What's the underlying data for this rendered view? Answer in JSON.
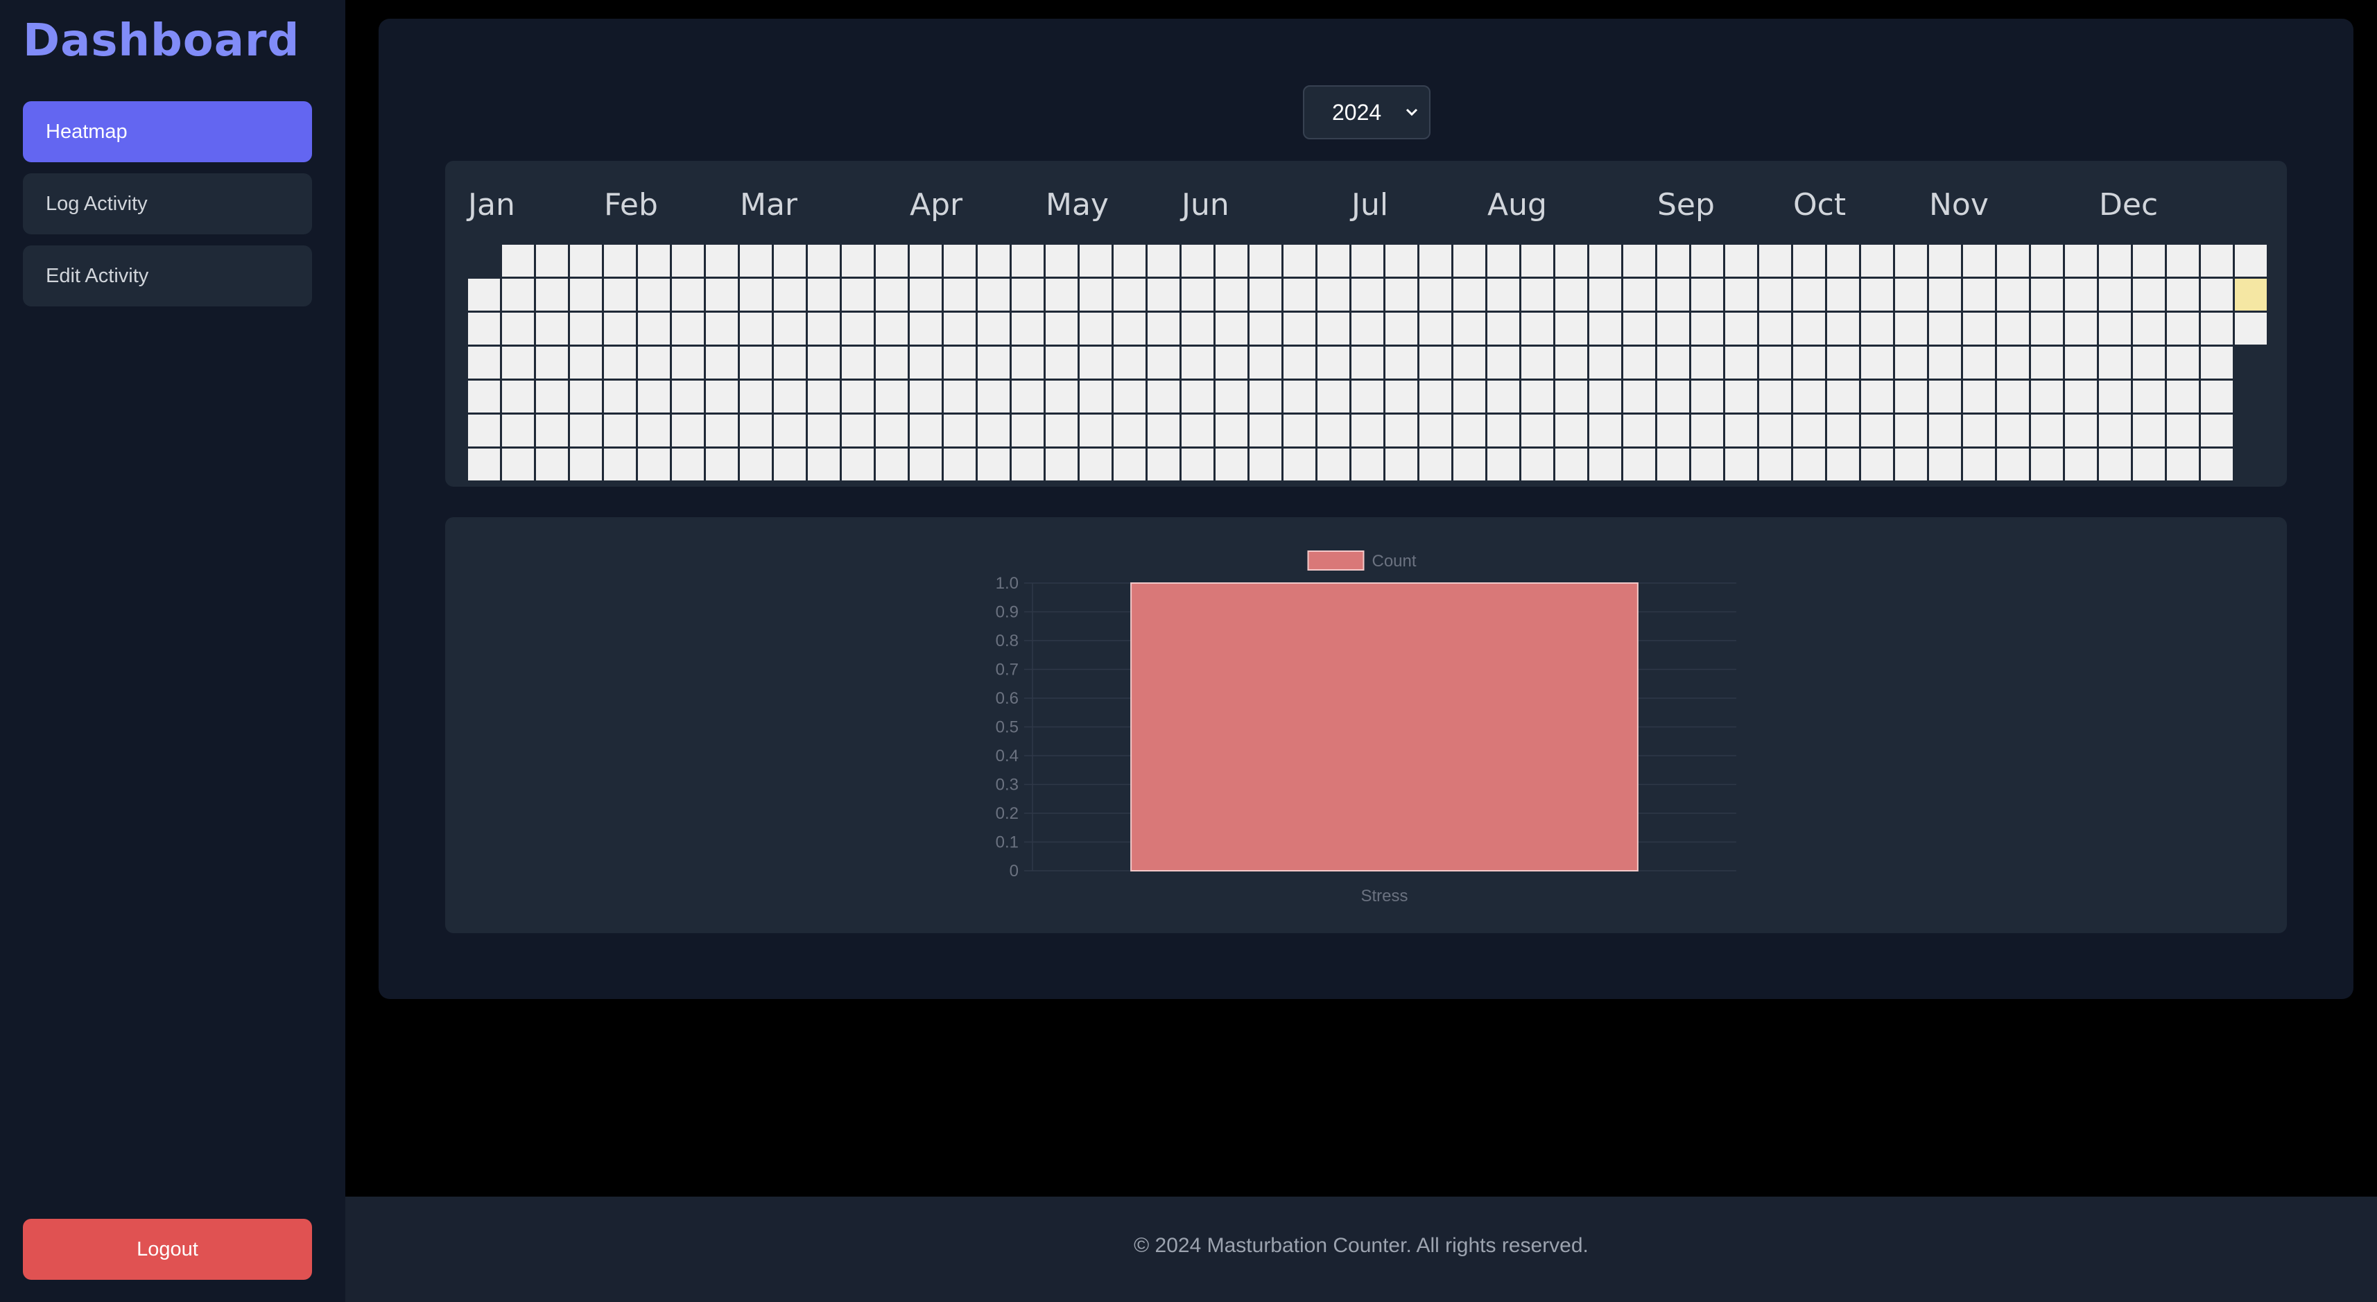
{
  "sidebar": {
    "brand": "Dashboard",
    "items": [
      {
        "label": "Heatmap",
        "active": true
      },
      {
        "label": "Log Activity",
        "active": false
      },
      {
        "label": "Edit Activity",
        "active": false
      }
    ],
    "logout_label": "Logout"
  },
  "year_select": {
    "selected": "2024",
    "chevron": "chevron-down-icon"
  },
  "heatmap": {
    "year": 2024,
    "months": [
      "Jan",
      "Feb",
      "Mar",
      "Apr",
      "May",
      "Jun",
      "Jul",
      "Aug",
      "Sep",
      "Oct",
      "Nov",
      "Dec"
    ],
    "active_dates": [
      "2024-12-30"
    ],
    "empty_color": "#f0f0f0",
    "active_color": "#f5e7a3"
  },
  "chart_data": {
    "type": "bar",
    "categories": [
      "Stress"
    ],
    "series": [
      {
        "name": "Count",
        "values": [
          1
        ]
      }
    ],
    "ylim": [
      0,
      1
    ],
    "yticks": [
      0,
      0.1,
      0.2,
      0.3,
      0.4,
      0.5,
      0.6,
      0.7,
      0.8,
      0.9,
      1.0
    ],
    "ytick_labels": [
      "0",
      "0.1",
      "0.2",
      "0.3",
      "0.4",
      "0.5",
      "0.6",
      "0.7",
      "0.8",
      "0.9",
      "1.0"
    ],
    "legend_position": "top",
    "bar_color": "#d97878",
    "grid": true
  },
  "footer": {
    "text": "© 2024 Masturbation Counter. All rights reserved."
  },
  "colors": {
    "accent": "#6366f1",
    "brand": "#818cf8",
    "danger": "#e05252",
    "panel": "#1f2937",
    "background": "#111827"
  }
}
